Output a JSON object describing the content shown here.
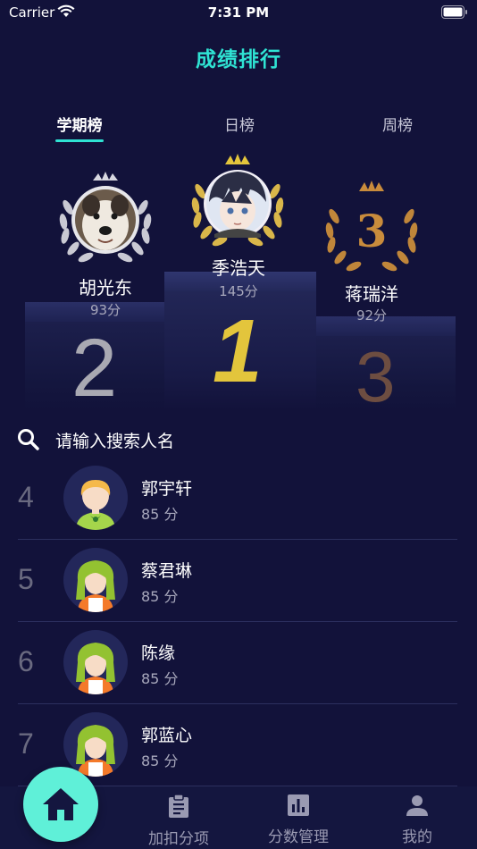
{
  "status_bar": {
    "carrier": "Carrier",
    "time": "7:31 PM"
  },
  "header": {
    "title": "成绩排行"
  },
  "tabs": [
    {
      "label": "学期榜",
      "active": true
    },
    {
      "label": "日榜",
      "active": false
    },
    {
      "label": "周榜",
      "active": false
    }
  ],
  "podium": {
    "first": {
      "rank": "1",
      "name": "季浩天",
      "score": "145分"
    },
    "second": {
      "rank": "2",
      "name": "胡光东",
      "score": "93分"
    },
    "third": {
      "rank": "3",
      "name": "蒋瑞洋",
      "score": "92分",
      "badge": "3"
    }
  },
  "search": {
    "placeholder": "请输入搜索人名"
  },
  "ranking_list": [
    {
      "rank": "4",
      "name": "郭宇轩",
      "score": "85 分",
      "avatar": "boy"
    },
    {
      "rank": "5",
      "name": "蔡君琳",
      "score": "85 分",
      "avatar": "girl"
    },
    {
      "rank": "6",
      "name": "陈缘",
      "score": "85 分",
      "avatar": "girl"
    },
    {
      "rank": "7",
      "name": "郭蓝心",
      "score": "85 分",
      "avatar": "girl"
    }
  ],
  "tab_bar": {
    "home_icon": "home-icon",
    "items": [
      {
        "label": "加扣分项",
        "icon": "clipboard-icon"
      },
      {
        "label": "分数管理",
        "icon": "bar-chart-icon"
      },
      {
        "label": "我的",
        "icon": "person-icon"
      }
    ]
  },
  "colors": {
    "background": "#12123a",
    "accent": "#2fe3d3",
    "gold": "#e3c53c",
    "home_button": "#5ff0d8"
  }
}
